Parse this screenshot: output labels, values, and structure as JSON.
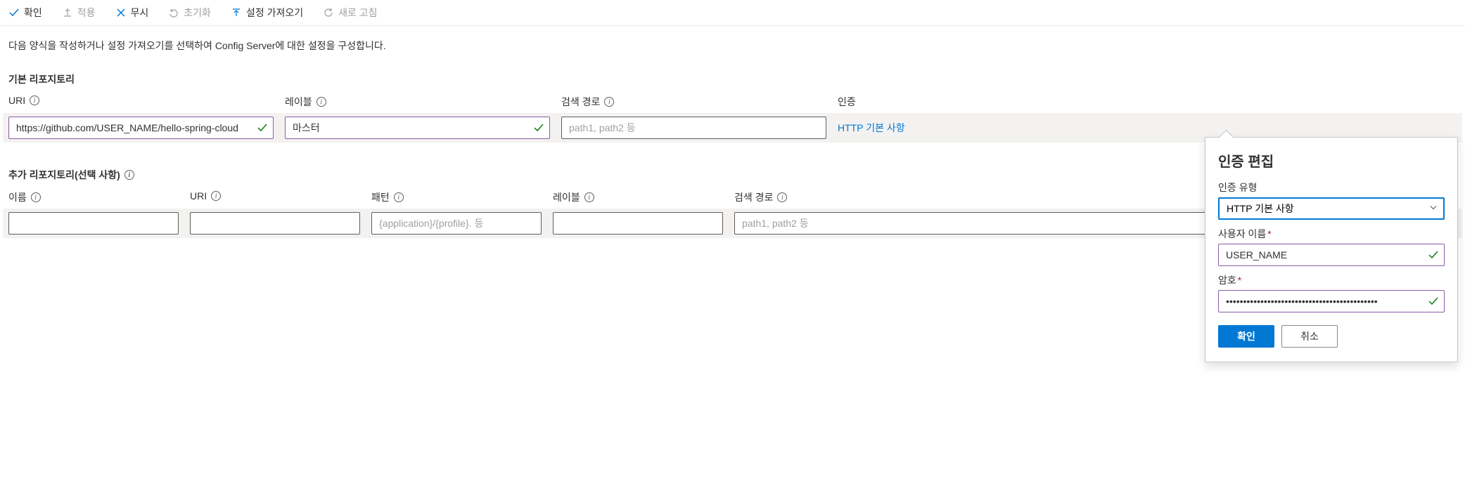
{
  "toolbar": {
    "confirm": "확인",
    "apply": "적용",
    "discard": "무시",
    "reset": "초기화",
    "import_settings": "설정 가져오기",
    "refresh": "새로 고침"
  },
  "description": "다음 양식을 작성하거나 설정 가져오기를 선택하여 Config Server에 대한 설정을 구성합니다.",
  "default_repo": {
    "section_title": "기본 리포지토리",
    "headers": {
      "uri": "URI",
      "label": "레이블",
      "search_path": "검색 경로",
      "auth": "인증"
    },
    "uri_value": "https://github.com/USER_NAME/hello-spring-cloud",
    "label_value": "마스터",
    "search_path_placeholder": "path1, path2 등",
    "auth_link": "HTTP 기본 사항"
  },
  "additional_repo": {
    "section_title": "추가 리포지토리(선택 사항)",
    "headers": {
      "name": "이름",
      "uri": "URI",
      "pattern": "패턴",
      "label": "레이블",
      "search_path": "검색 경로"
    },
    "pattern_placeholder": "{application}/{profile}. 등",
    "search_path_placeholder": "path1, path2 등"
  },
  "popup": {
    "title": "인증 편집",
    "auth_type_label": "인증 유형",
    "auth_type_value": "HTTP 기본 사항",
    "username_label": "사용자 이름",
    "username_value": "USER_NAME",
    "password_label": "암호",
    "password_value": "••••••••••••••••••••••••••••••••••••••••••••",
    "confirm_button": "확인",
    "cancel_button": "취소"
  }
}
